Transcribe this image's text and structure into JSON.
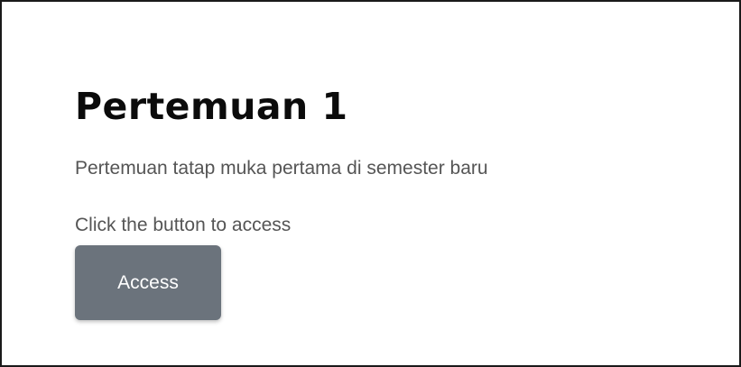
{
  "card": {
    "title": "Pertemuan 1",
    "description": "Pertemuan tatap muka pertama di semester baru",
    "hint": "Click the button to access",
    "button_label": "Access"
  },
  "colors": {
    "button_background": "#6b737c",
    "button_text": "#ffffff",
    "body_text": "#555555",
    "title_text": "#0b0b0b",
    "border": "#1a1a1a"
  }
}
